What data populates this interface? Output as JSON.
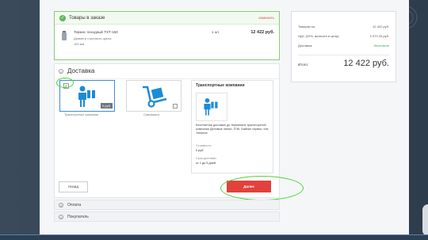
{
  "order": {
    "title": "Товары в заказе",
    "edit_label": "изменить",
    "product": {
      "name": "Термос походный ТХТ-160",
      "line2": "Диаметр горлового цикла",
      "line3": "160 мм",
      "qty": "1 шт.",
      "price": "12 422 руб."
    }
  },
  "summary": {
    "goods_label": "Товаров на:",
    "goods_value": "12 422 руб.",
    "vat_label": "НДС (20%, включен в цену):",
    "vat_value": "2 070.33 руб.",
    "delivery_label": "Доставка:",
    "delivery_value": "бесплатно",
    "total_label": "Итого:",
    "total_value": "12 422 руб."
  },
  "delivery": {
    "step": "2",
    "title": "Доставка",
    "option_a": {
      "label": "Транспортные компании",
      "price": "0 руб.",
      "checked": "✓"
    },
    "option_b": {
      "label": "Самовывоз"
    },
    "info": {
      "title": "Транспортные компании",
      "desc": "Бесплатная доставка до терминала транспортной компании Деловые линии, ПЭК, Байкал сервис, Кит, Энергия",
      "cost_label": "Стоимость:",
      "cost_value": "0 руб.",
      "term_label": "Срок доставки:",
      "term_value": "от 1 до 5 дней"
    },
    "back_label": "Назад",
    "next_label": "Далее"
  },
  "sections": [
    {
      "step": "3",
      "label": "Оплата"
    },
    {
      "step": "4",
      "label": "Покупатель"
    }
  ],
  "colors": {
    "accent_red": "#e3413c",
    "selected_blue": "#3b8ed4",
    "check_green": "#5cb85c",
    "highlight_ring": "#4cd43a"
  }
}
